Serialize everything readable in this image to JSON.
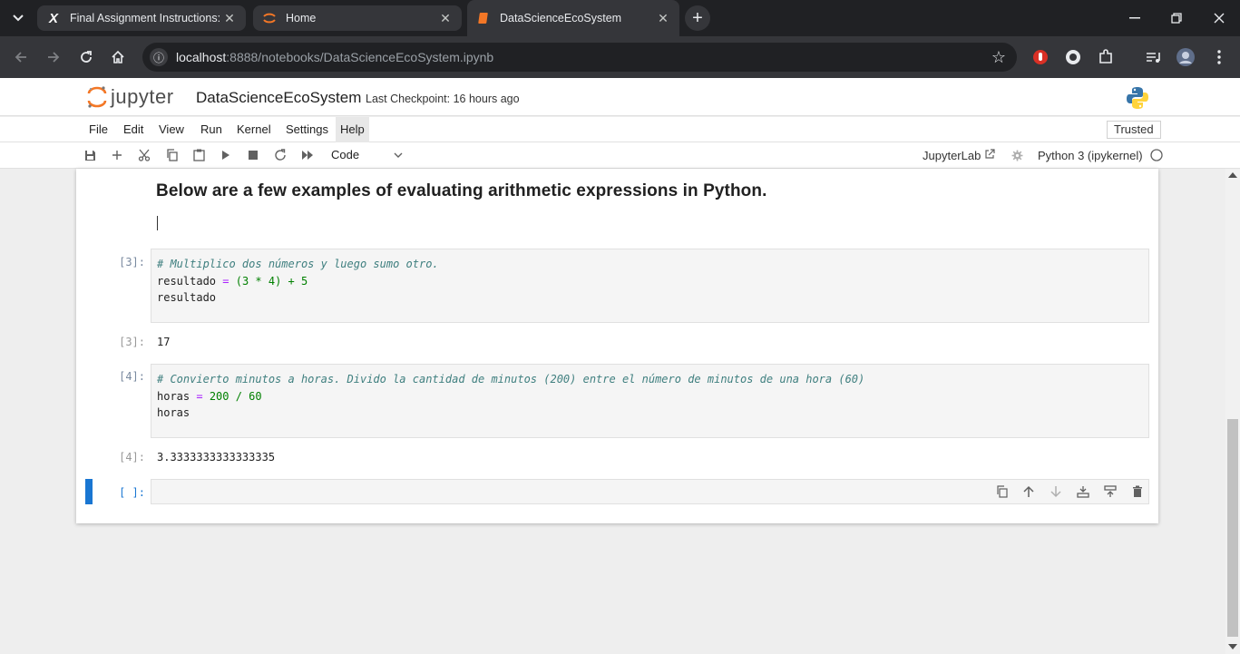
{
  "browser": {
    "tabs": [
      {
        "title": "Final Assignment Instructions: C",
        "icon": "x-icon"
      },
      {
        "title": "Home",
        "icon": "jupyter-icon"
      },
      {
        "title": "DataScienceEcoSystem",
        "icon": "notebook-icon"
      }
    ],
    "url_host": "localhost",
    "url_rest": ":8888/notebooks/DataScienceEcoSystem.ipynb"
  },
  "jupyter": {
    "logo_text": "jupyter",
    "notebook_title": "DataScienceEcoSystem",
    "checkpoint": "Last Checkpoint: 16 hours ago",
    "menu": [
      "File",
      "Edit",
      "View",
      "Run",
      "Kernel",
      "Settings",
      "Help"
    ],
    "trusted": "Trusted",
    "cell_type": "Code",
    "jupyterlab_link": "JupyterLab",
    "kernel": "Python 3 (ipykernel)"
  },
  "notebook": {
    "markdown_heading": "Below are a few examples of evaluating arithmetic expressions in Python.",
    "cells": [
      {
        "prompt": "[3]:",
        "line1": "# Multiplico dos números y luego sumo otro.",
        "line2_var": "resultado",
        "line2_eq": " = ",
        "line2_rest": "(3 * 4) + 5",
        "line3": "resultado",
        "out_prompt": "[3]:",
        "output": "17"
      },
      {
        "prompt": "[4]:",
        "line1": "# Convierto minutos a horas. Divido la cantidad de minutos (200) entre el número de minutos de una hora (60)",
        "line2_var": "horas",
        "line2_eq": " = ",
        "line2_rest": "200 / 60",
        "line3": "horas",
        "out_prompt": "[4]:",
        "output": "3.3333333333333335"
      }
    ],
    "empty_prompt": "[ ]:"
  }
}
